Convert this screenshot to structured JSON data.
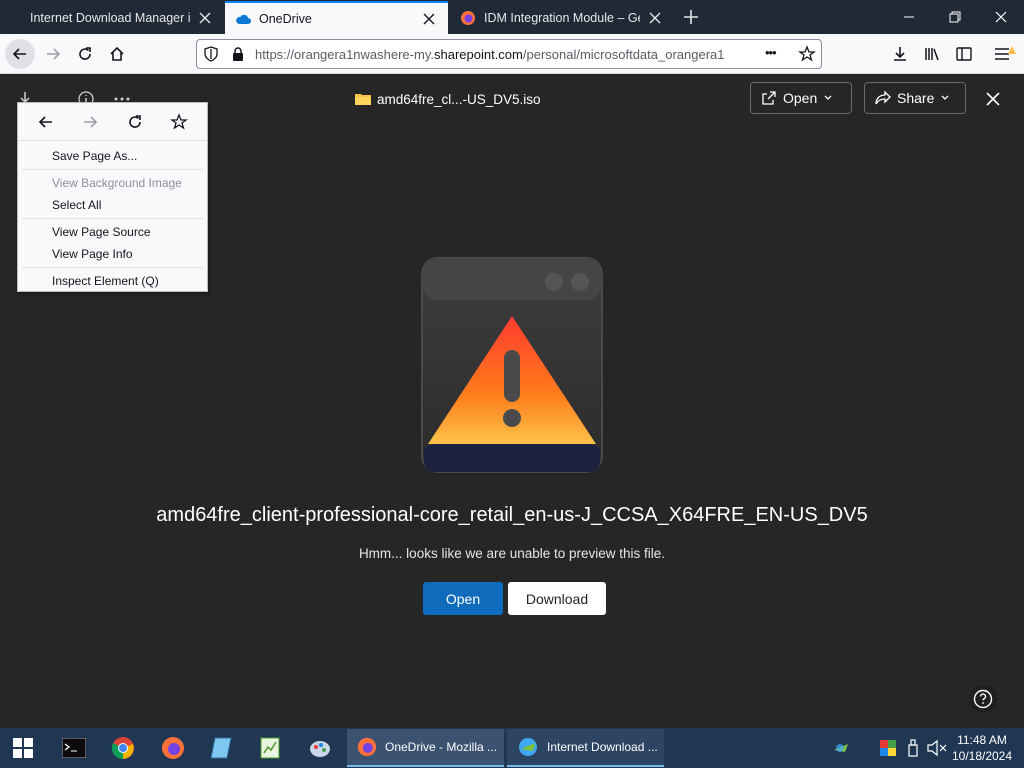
{
  "browser": {
    "tabs": [
      {
        "title": "Internet Download Manager is",
        "active": false
      },
      {
        "title": "OneDrive",
        "active": true
      },
      {
        "title": "IDM Integration Module – Get",
        "active": false
      }
    ],
    "url_prefix": "https://",
    "url_host_pre": "orangera1nwashere-my.",
    "url_host": "sharepoint.com",
    "url_path": "/personal/microsoftdata_orangera1",
    "more_glyph": "•••"
  },
  "context_menu": {
    "items": [
      {
        "label": "Save Page As...",
        "enabled": true
      },
      {
        "label": "View Background Image",
        "enabled": false
      },
      {
        "label": "Select All",
        "enabled": true
      },
      {
        "label": "View Page Source",
        "enabled": true
      },
      {
        "label": "View Page Info",
        "enabled": true
      },
      {
        "label": "Inspect Element (Q)",
        "enabled": true
      }
    ]
  },
  "viewer": {
    "file_name": "amd64fre_cl...-US_DV5.iso",
    "open_label": "Open",
    "share_label": "Share",
    "error_title": "amd64fre_client-professional-core_retail_en-us-J_CCSA_X64FRE_EN-US_DV5",
    "error_message": "Hmm... looks like we are unable to preview this file.",
    "primary_open_label": "Open",
    "download_label": "Download",
    "accent_color": "#0f6cbd"
  },
  "taskbar": {
    "tasks": [
      {
        "label": "OneDrive - Mozilla ..."
      },
      {
        "label": "Internet Download ..."
      }
    ],
    "time": "11:48 AM",
    "date": "10/18/2024"
  }
}
